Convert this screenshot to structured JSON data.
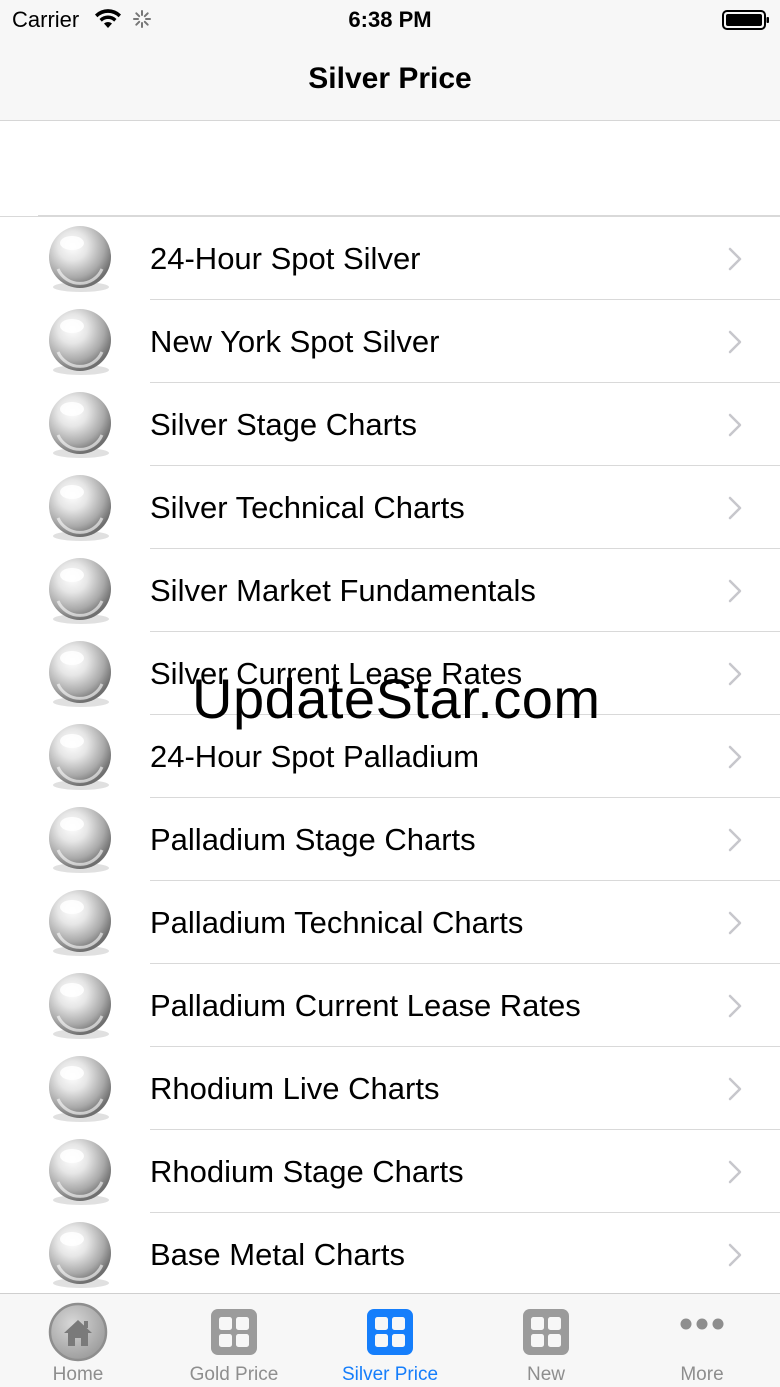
{
  "status_bar": {
    "carrier": "Carrier",
    "time": "6:38 PM"
  },
  "nav": {
    "title": "Silver Price"
  },
  "list": {
    "items": [
      {
        "label": "24-Hour Spot Silver",
        "icon": "silver-ball-icon"
      },
      {
        "label": "New York Spot Silver",
        "icon": "silver-ball-icon"
      },
      {
        "label": "Silver Stage Charts",
        "icon": "silver-ball-icon"
      },
      {
        "label": "Silver Technical Charts",
        "icon": "silver-ball-icon"
      },
      {
        "label": "Silver Market Fundamentals",
        "icon": "silver-ball-icon"
      },
      {
        "label": "Silver Current Lease Rates",
        "icon": "silver-ball-icon"
      },
      {
        "label": "24-Hour Spot Palladium",
        "icon": "silver-ball-icon"
      },
      {
        "label": "Palladium Stage Charts",
        "icon": "silver-ball-icon"
      },
      {
        "label": "Palladium Technical Charts",
        "icon": "silver-ball-icon"
      },
      {
        "label": "Palladium Current Lease Rates",
        "icon": "silver-ball-icon"
      },
      {
        "label": "Rhodium Live Charts",
        "icon": "silver-ball-icon"
      },
      {
        "label": "Rhodium Stage Charts",
        "icon": "silver-ball-icon"
      },
      {
        "label": "Base Metal Charts",
        "icon": "silver-ball-icon"
      }
    ]
  },
  "watermark": "UpdateStar.com",
  "tabs": [
    {
      "label": "Home",
      "icon": "home-icon",
      "active": false
    },
    {
      "label": "Gold Price",
      "icon": "grid-icon",
      "active": false
    },
    {
      "label": "Silver Price",
      "icon": "grid-icon",
      "active": true
    },
    {
      "label": "New",
      "icon": "grid-icon",
      "active": false
    },
    {
      "label": "More",
      "icon": "more-icon",
      "active": false
    }
  ],
  "colors": {
    "accent": "#157efb",
    "inactive": "#8e8e8e",
    "bar_background": "#f7f7f7",
    "separator": "#d9d9d9"
  }
}
